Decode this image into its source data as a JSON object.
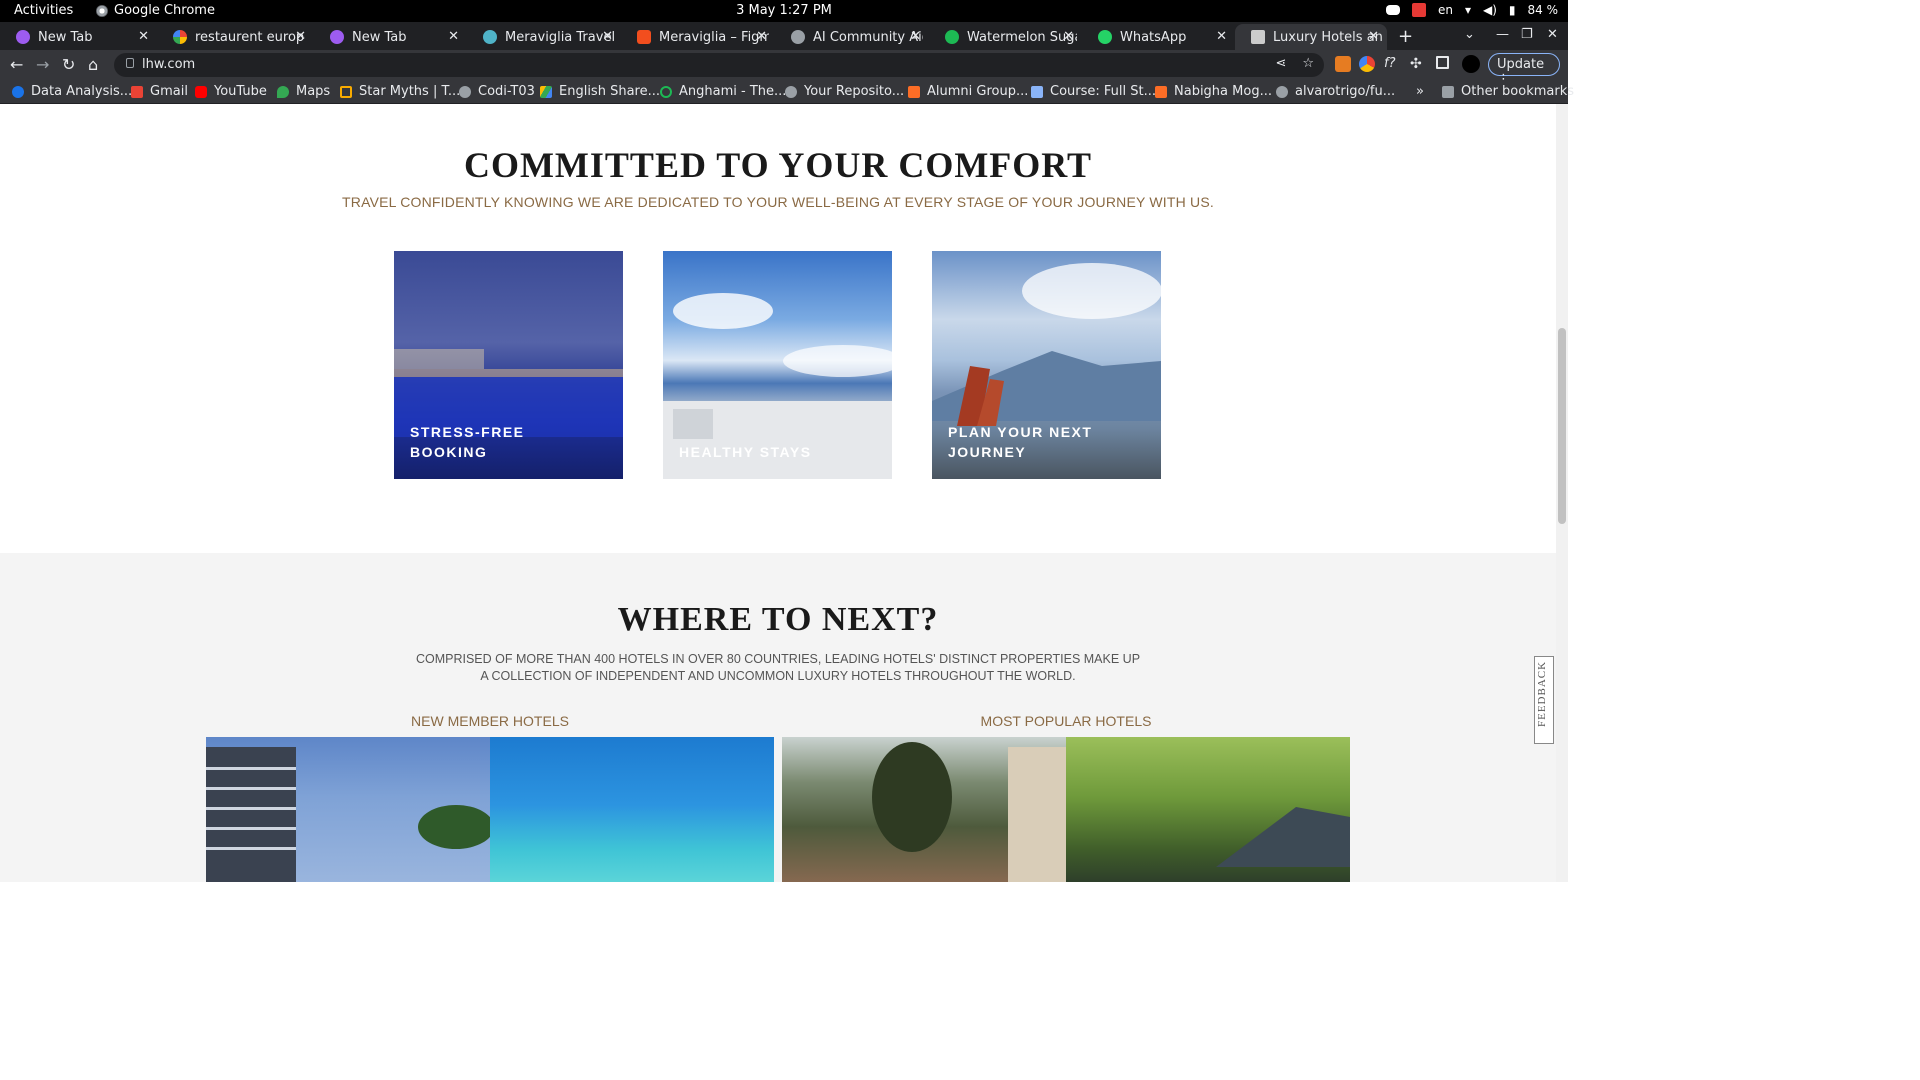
{
  "system_bar": {
    "activities": "Activities",
    "app_name": "Google Chrome",
    "clock": "3 May  1:27 PM",
    "lang": "en",
    "battery": "84 %"
  },
  "tabs": [
    {
      "label": "New Tab",
      "color": "#9d5cf0"
    },
    {
      "label": "restaurent europe",
      "color": "#ffffff"
    },
    {
      "label": "New Tab",
      "color": "#9d5cf0"
    },
    {
      "label": "Meraviglia Travel /",
      "color": "#4fb3c8"
    },
    {
      "label": "Meraviglia – Figma",
      "color": "#f24e1e"
    },
    {
      "label": "AI Community Aid",
      "color": "#9aa0a6"
    },
    {
      "label": "Watermelon Suga",
      "color": "#1db954"
    },
    {
      "label": "WhatsApp",
      "color": "#25d366"
    },
    {
      "label": "Luxury Hotels and",
      "color": "#cccccc"
    }
  ],
  "address_bar": {
    "url": "lhw.com",
    "update_label": "Update"
  },
  "bookmarks": [
    {
      "label": "Data Analysis...",
      "color": "#1a73e8"
    },
    {
      "label": "Gmail",
      "color": "#ea4335"
    },
    {
      "label": "YouTube",
      "color": "#ff0000"
    },
    {
      "label": "Maps",
      "color": "#34a853"
    },
    {
      "label": "Star Myths | T...",
      "color": "#f9ab00"
    },
    {
      "label": "Codi-T03",
      "color": "#9aa0a6"
    },
    {
      "label": "English Share...",
      "color": "#fbbc04"
    },
    {
      "label": "Anghami - The...",
      "color": "#1db954"
    },
    {
      "label": "Your Reposito...",
      "color": "#9aa0a6"
    },
    {
      "label": "Alumni Group...",
      "color": "#fc6d26"
    },
    {
      "label": "Course: Full St...",
      "color": "#8ab4f8"
    },
    {
      "label": "Nabigha Mog...",
      "color": "#fc6d26"
    },
    {
      "label": "alvarotrigo/fu...",
      "color": "#9aa0a6"
    }
  ],
  "other_bookmarks": "Other bookmarks",
  "comfort": {
    "title": "COMMITTED TO YOUR COMFORT",
    "subtitle": "TRAVEL CONFIDENTLY KNOWING WE ARE DEDICATED TO YOUR WELL-BEING AT EVERY STAGE OF YOUR JOURNEY WITH US.",
    "cards": [
      {
        "label": "STRESS-FREE BOOKING"
      },
      {
        "label": "HEALTHY STAYS"
      },
      {
        "label": "PLAN YOUR NEXT JOURNEY"
      }
    ]
  },
  "where": {
    "title": "WHERE TO NEXT?",
    "desc_line1": "COMPRISED OF MORE THAN 400 HOTELS IN OVER 80 COUNTRIES, LEADING HOTELS' DISTINCT PROPERTIES MAKE UP",
    "desc_line2": "A COLLECTION OF INDEPENDENT AND UNCOMMON LUXURY HOTELS THROUGHOUT THE WORLD.",
    "new_member": "NEW MEMBER HOTELS",
    "most_popular": "MOST POPULAR HOTELS"
  },
  "feedback_label": "FEEDBACK"
}
